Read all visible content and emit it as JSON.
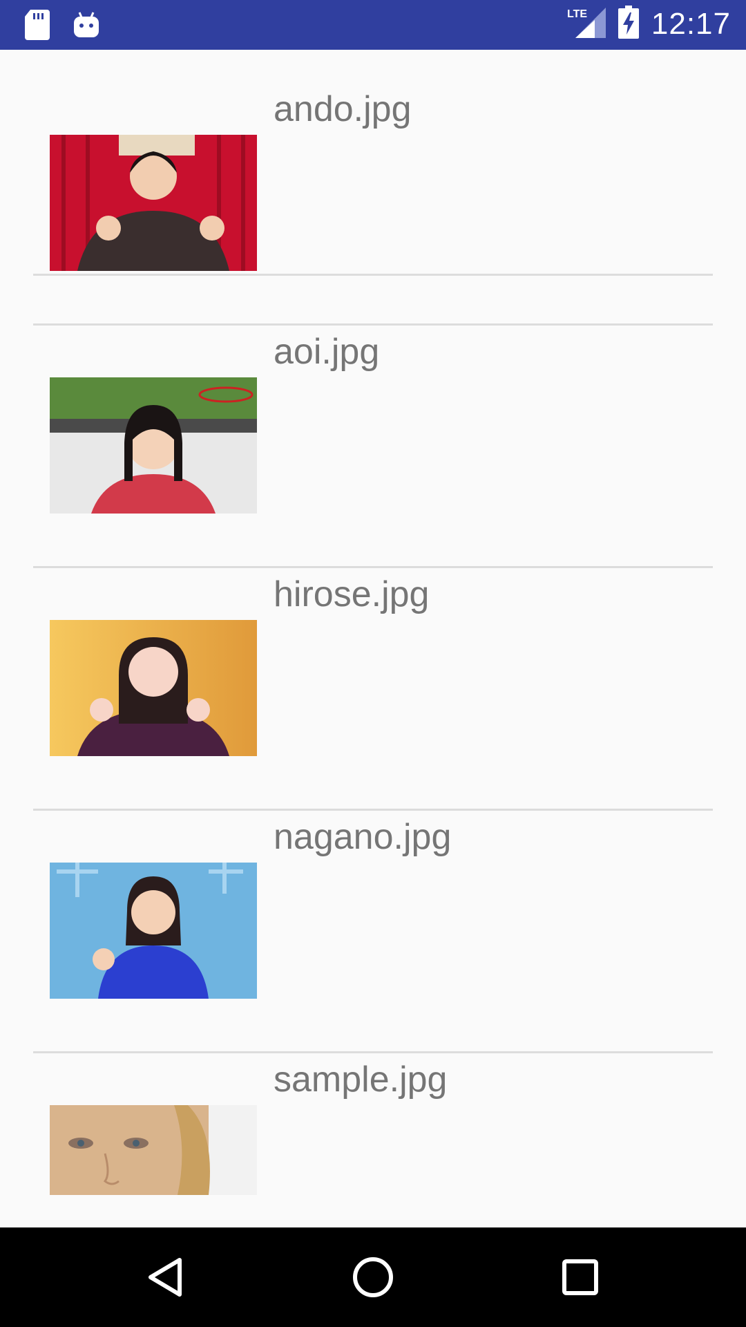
{
  "status_bar": {
    "time": "12:17",
    "network_label": "LTE",
    "icons": [
      "sd-card-icon",
      "android-icon",
      "lte-signal-icon",
      "battery-charging-icon"
    ]
  },
  "files": [
    {
      "name": "ando.jpg",
      "thumb_colors": [
        "#c8102e",
        "#3a2e2e"
      ]
    },
    {
      "name": "aoi.jpg",
      "thumb_colors": [
        "#5a8a3c",
        "#d23a4a"
      ]
    },
    {
      "name": "hirose.jpg",
      "thumb_colors": [
        "#f0b84a",
        "#4a2040"
      ]
    },
    {
      "name": "nagano.jpg",
      "thumb_colors": [
        "#6fb4e0",
        "#2b3fd0"
      ]
    },
    {
      "name": "sample.jpg",
      "thumb_colors": [
        "#d9b48c",
        "#f2f2f2"
      ]
    }
  ],
  "nav_bar": {
    "buttons": [
      "back-icon",
      "home-icon",
      "recents-icon"
    ]
  }
}
